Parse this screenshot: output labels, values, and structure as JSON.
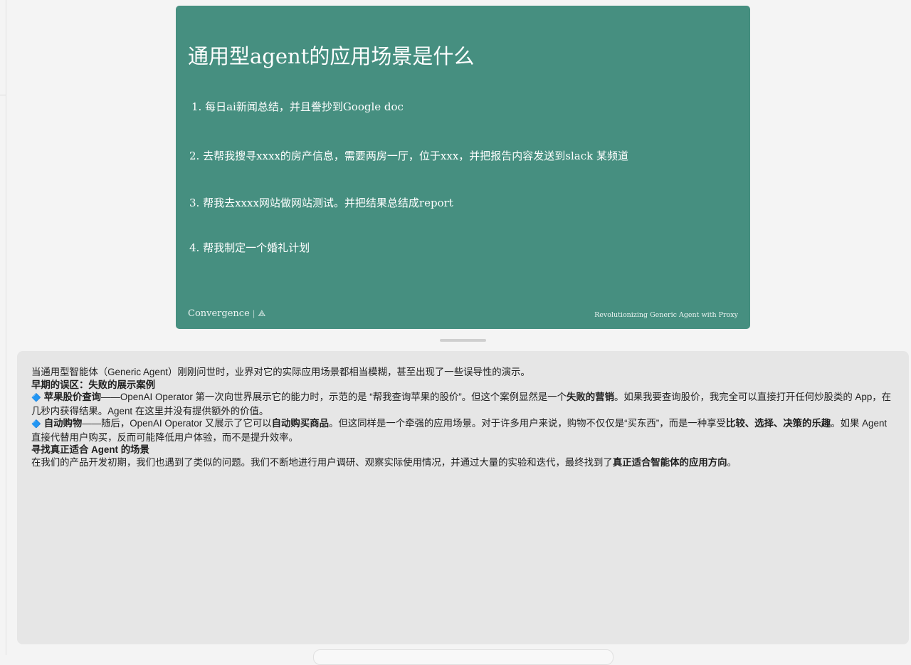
{
  "slide": {
    "title": "通用型agent的应用场景是什么",
    "items": [
      "1. 每日ai新闻总结，并且誊抄到Google doc",
      "2. 去帮我搜寻xxxx的房产信息，需要两房一厅，位于xxx，并把报告内容发送到slack 某频道",
      "3. 帮我去xxxx网站做网站测试。并把结果总结成report",
      "4. 帮我制定一个婚礼计划"
    ],
    "footer_logo": "Convergence",
    "footer_logo_sep": "|",
    "footer_logo_mark": "⟁",
    "footer_tagline": "Revolutionizing Generic Agent with Proxy"
  },
  "notes": {
    "intro": "当通用型智能体（Generic Agent）刚刚问世时，业界对它的实际应用场景都相当模糊，甚至出现了一些误导性的演示。",
    "heading1": "早期的误区：失败的展示案例",
    "bullet1": {
      "icon": "🔷",
      "bold_title": "苹果股价查询",
      "text_a": "——OpenAI Operator 第一次向世界展示它的能力时，示范的是 “帮我查询苹果的股价”。但这个案例显然是一个",
      "bold_a": "失败的营销",
      "text_b": "。如果我要查询股价，我完全可以直接打开任何炒股类的 App，在几秒内获得结果。Agent 在这里并没有提供额外的价值。"
    },
    "bullet2": {
      "icon": "🔷",
      "bold_title": "自动购物",
      "text_a": "——随后，OpenAI Operator 又展示了它可以",
      "bold_a": "自动购买商品",
      "text_b": "。但这同样是一个牵强的应用场景。对于许多用户来说，购物不仅仅是“买东西”，而是一种享受",
      "bold_b": "比较、选择、决策的乐趣",
      "text_c": "。如果 Agent 直接代替用户购买，反而可能降低用户体验，而不是提升效率。"
    },
    "heading2": "寻找真正适合 Agent 的场景",
    "closing": {
      "text_a": "在我们的产品开发初期，我们也遇到了类似的问题。我们不断地进行用户调研、观察实际使用情况，并通过大量的实验和迭代，最终找到了",
      "bold_a": "真正适合智能体的应用方向",
      "text_b": "。"
    }
  }
}
